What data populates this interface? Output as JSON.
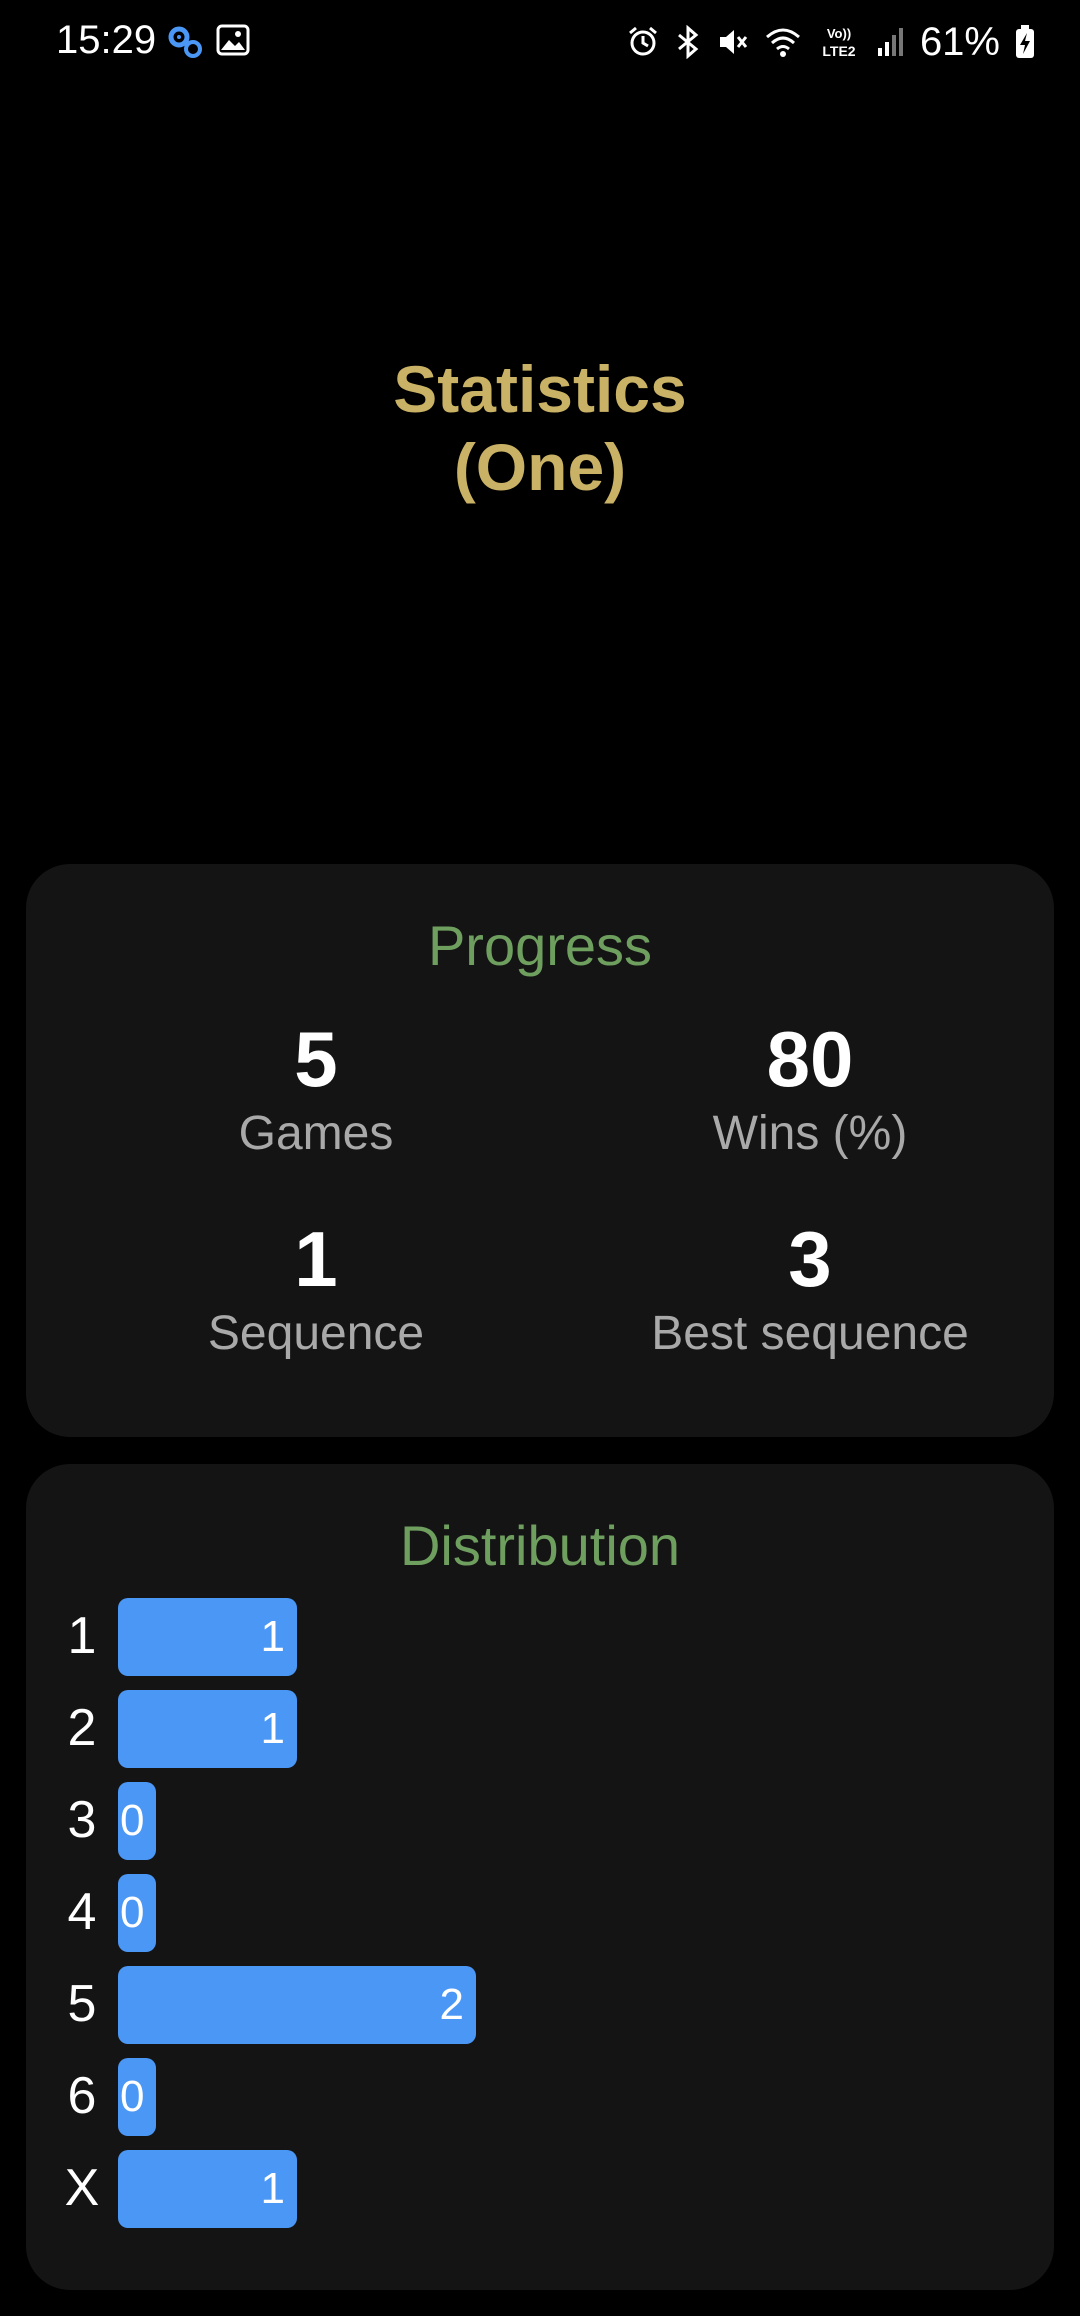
{
  "status_bar": {
    "time": "15:29",
    "battery_percent": "61%",
    "network_label": "Vo) LTE2",
    "icons_left": [
      "settings-gears-icon",
      "image-icon"
    ],
    "icons_right": [
      "alarm-icon",
      "bluetooth-icon",
      "mute-icon",
      "wifi-icon",
      "lte-icon",
      "signal-icon",
      "battery-charging-icon"
    ]
  },
  "title": {
    "line1": "Statistics",
    "line2": "(One)"
  },
  "progress": {
    "heading": "Progress",
    "games_value": "5",
    "games_label": "Games",
    "wins_value": "80",
    "wins_label": "Wins (%)",
    "sequence_value": "1",
    "sequence_label": "Sequence",
    "best_value": "3",
    "best_label": "Best sequence"
  },
  "distribution": {
    "heading": "Distribution",
    "rows": [
      {
        "label": "1",
        "count": "1",
        "value": 1
      },
      {
        "label": "2",
        "count": "1",
        "value": 1
      },
      {
        "label": "3",
        "count": "0",
        "value": 0
      },
      {
        "label": "4",
        "count": "0",
        "value": 0
      },
      {
        "label": "5",
        "count": "2",
        "value": 2
      },
      {
        "label": "6",
        "count": "0",
        "value": 0
      },
      {
        "label": "X",
        "count": "1",
        "value": 1
      }
    ]
  },
  "colors": {
    "title": "#c9b265",
    "heading": "#6e9f5f",
    "bar": "#4a97f5",
    "card": "#141414"
  }
}
